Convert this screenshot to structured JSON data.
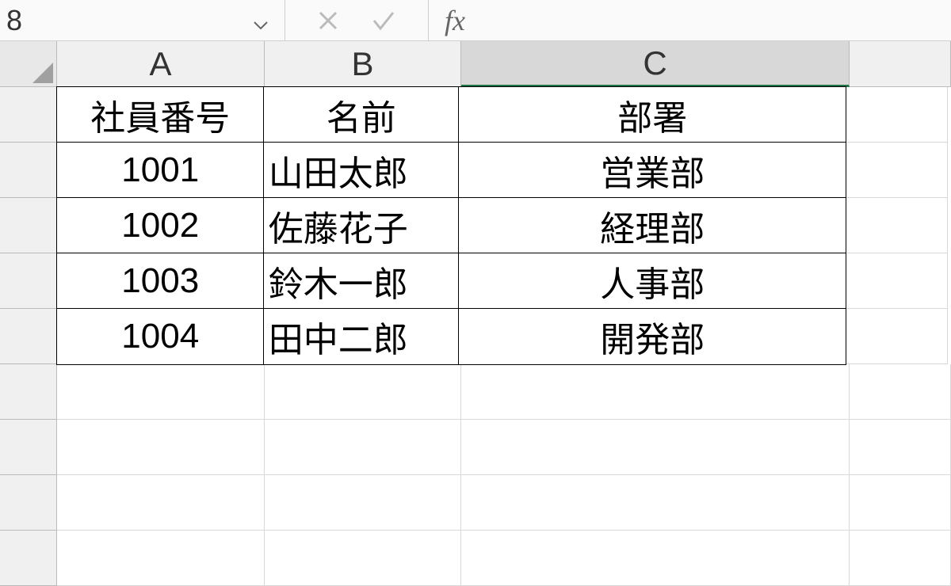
{
  "formulaBar": {
    "nameBox": "8",
    "fxLabel": "fx"
  },
  "columns": [
    "A",
    "B",
    "C"
  ],
  "selectedColumn": "C",
  "table": {
    "headers": [
      "社員番号",
      "名前",
      "部署"
    ],
    "rows": [
      [
        "1001",
        "山田太郎",
        "営業部"
      ],
      [
        "1002",
        "佐藤花子",
        "経理部"
      ],
      [
        "1003",
        "鈴木一郎",
        "人事部"
      ],
      [
        "1004",
        "田中二郎",
        "開発部"
      ]
    ]
  }
}
